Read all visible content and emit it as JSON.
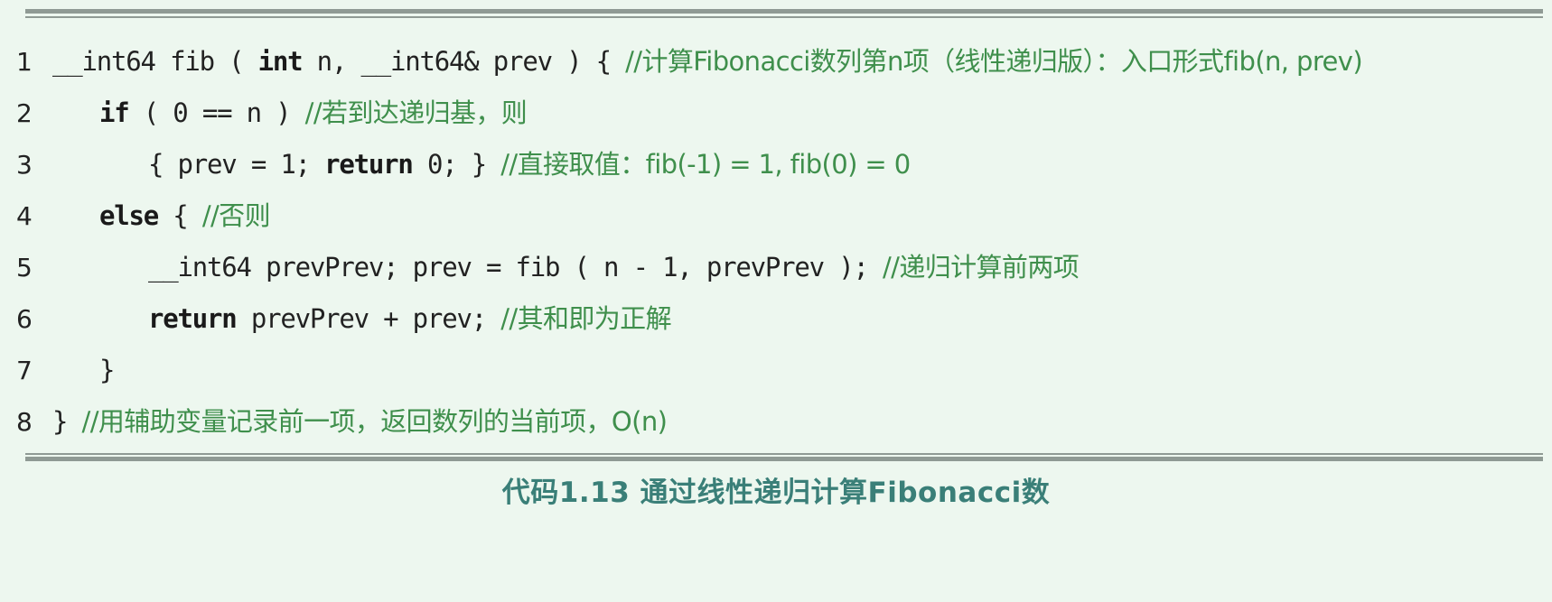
{
  "lines": [
    {
      "no": "1",
      "code": "__int64 fib ( ",
      "kw1": "int",
      "code2": " n, __int64& prev ) { ",
      "comment": "//计算Fibonacci数列第n项（线性递归版）：入口形式fib(n, prev)"
    },
    {
      "no": "2",
      "kw1": "if",
      "code": " ( 0 == n ) ",
      "comment": "//若到达递归基，则"
    },
    {
      "no": "3",
      "code": "{ prev = 1; ",
      "kw1": "return",
      "code2": " 0; } ",
      "comment": "//直接取值：fib(-1) = 1, fib(0) = 0"
    },
    {
      "no": "4",
      "kw1": "else",
      "code": " { ",
      "comment": "//否则"
    },
    {
      "no": "5",
      "code": "__int64 prevPrev; prev = fib ( n - 1, prevPrev ); ",
      "comment": "//递归计算前两项"
    },
    {
      "no": "6",
      "kw1": "return",
      "code": " prevPrev + prev; ",
      "comment": "//其和即为正解"
    },
    {
      "no": "7",
      "code": "}"
    },
    {
      "no": "8",
      "code": "} ",
      "comment": "//用辅助变量记录前一项，返回数列的当前项，O(n)"
    }
  ],
  "caption": "代码1.13 通过线性递归计算Fibonacci数",
  "colors": {
    "background": "#edf7ef",
    "comment": "#3f8f4c",
    "caption": "#3a7f78",
    "rule": "#8f9a94"
  }
}
